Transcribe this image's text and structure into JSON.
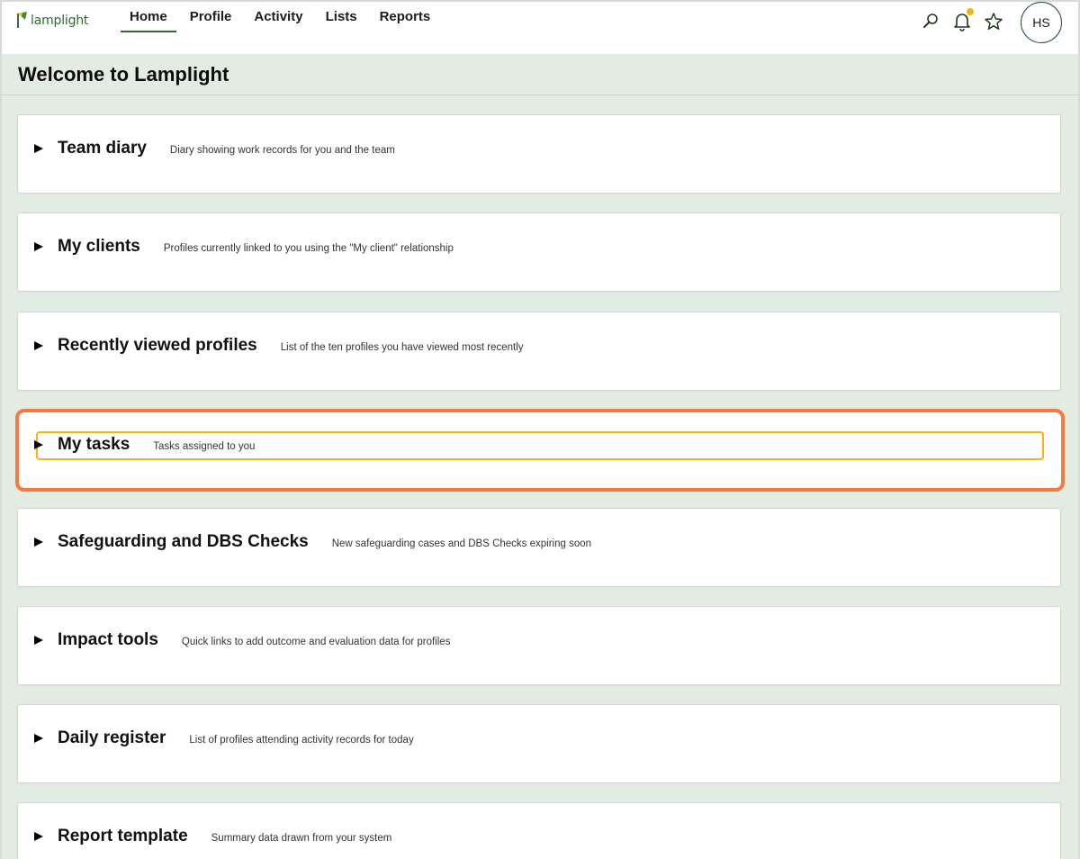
{
  "app": {
    "logo_text": "lamplight"
  },
  "nav": {
    "items": [
      {
        "label": "Home",
        "active": true
      },
      {
        "label": "Profile"
      },
      {
        "label": "Activity"
      },
      {
        "label": "Lists"
      },
      {
        "label": "Reports"
      }
    ]
  },
  "header_icons": [
    "search-icon",
    "bell-icon",
    "star-icon"
  ],
  "user": {
    "initials": "HS"
  },
  "page": {
    "title": "Welcome to Lamplight"
  },
  "panels": [
    {
      "title": "Team diary",
      "description": "Diary showing work records for you and the team"
    },
    {
      "title": "My clients",
      "description": "Profiles currently linked to you using the \"My client\" relationship"
    },
    {
      "title": "Recently viewed profiles",
      "description": "List of the ten profiles you have viewed most recently"
    },
    {
      "title": "My tasks",
      "description": "Tasks assigned to you",
      "highlighted": true
    },
    {
      "title": "Safeguarding and DBS Checks",
      "description": "New safeguarding cases and DBS Checks expiring soon"
    },
    {
      "title": "Impact tools",
      "description": "Quick links to add outcome and evaluation data for profiles"
    },
    {
      "title": "Daily register",
      "description": "List of profiles attending activity records for today"
    },
    {
      "title": "Report template",
      "description": "Summary data drawn from your system"
    }
  ],
  "colors": {
    "brand": "#2d6a2e",
    "background": "#e3ece2",
    "highlight": "#f47a3f",
    "focus": "#f5b316",
    "notification": "#f2b50a"
  }
}
